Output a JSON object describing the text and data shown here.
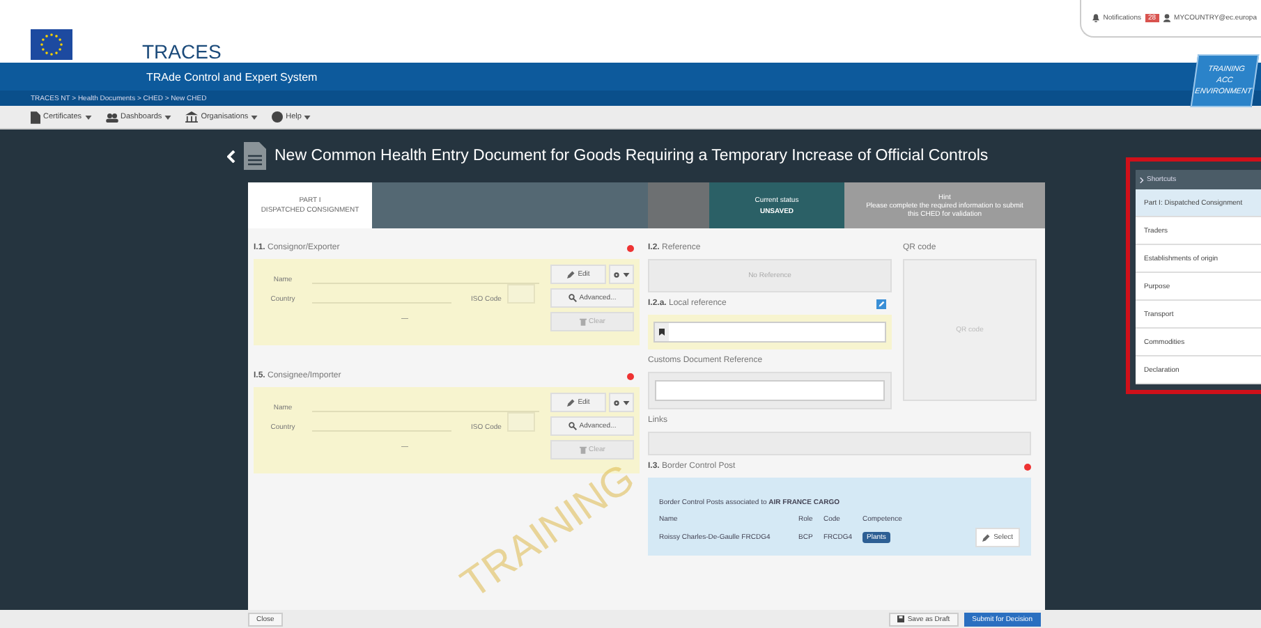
{
  "header": {
    "system": "TRACES",
    "subtitle": "TRAde Control and Expert System",
    "breadcrumb": "TRACES NT > Health Documents > CHED > New CHED",
    "notifications": {
      "label": "Notifications",
      "count": "28"
    },
    "user": "MYCOUNTRY@ec.europa",
    "environment": [
      "TRAINING",
      "ACC",
      "ENVIRONMENT"
    ]
  },
  "menu": [
    {
      "label": "Certificates"
    },
    {
      "label": "Dashboards"
    },
    {
      "label": "Organisations"
    },
    {
      "label": "Help"
    }
  ],
  "title": "New Common Health Entry Document for Goods Requiring a Temporary Increase of Official Controls",
  "tabs": [
    {
      "label": "PART I",
      "sublabel": "DISPATCHED CONSIGNMENT",
      "selected": true
    }
  ],
  "status": {
    "label": "Current status",
    "value": "UNSAVED"
  },
  "hint": {
    "label": "Hint",
    "text": "Please complete the required information to submit this CHED for validation"
  },
  "parties": [
    {
      "number": "I.1.",
      "title": "Consignor/Exporter",
      "required": true,
      "name_label": "Name",
      "country_label": "Country",
      "iso_label": "ISO Code",
      "dash": "—",
      "edit": "Edit",
      "advanced": "Advanced...",
      "clear": "Clear"
    },
    {
      "number": "I.5.",
      "title": "Consignee/Importer",
      "required": true,
      "name_label": "Name",
      "country_label": "Country",
      "iso_label": "ISO Code",
      "dash": "—",
      "edit": "Edit",
      "advanced": "Advanced...",
      "clear": "Clear"
    }
  ],
  "reference": {
    "number": "I.2.",
    "title": "Reference",
    "value": "No Reference"
  },
  "qr": {
    "title": "QR code",
    "placeholder": "QR code"
  },
  "local_reference": {
    "number": "I.2.a.",
    "title": "Local reference"
  },
  "customs": {
    "title": "Customs Document Reference"
  },
  "links": {
    "title": "Links"
  },
  "bcp": {
    "number": "I.3.",
    "title": "Border Control Post",
    "required": true,
    "intro": "Border Control Posts associated to",
    "company": "AIR FRANCE CARGO",
    "columns": [
      "Name",
      "Role",
      "Code",
      "Competence"
    ],
    "row": {
      "name": "Roissy Charles-De-Gaulle FRCDG4",
      "role": "BCP",
      "code": "FRCDG4",
      "competence": "Plants"
    },
    "select": "Select"
  },
  "watermark": "TRAINING",
  "shortcuts": {
    "title": "Shortcuts",
    "items": [
      {
        "label": "Part I: Dispatched Consignment",
        "selected": true
      },
      {
        "label": "Traders",
        "selected": false
      },
      {
        "label": "Establishments of origin",
        "selected": false
      },
      {
        "label": "Purpose",
        "selected": false
      },
      {
        "label": "Transport",
        "selected": false
      },
      {
        "label": "Commodities",
        "selected": false
      },
      {
        "label": "Declaration",
        "selected": false
      }
    ]
  },
  "footer": {
    "close": "Close",
    "save": "Save as Draft",
    "submit": "Submit for Decision"
  }
}
